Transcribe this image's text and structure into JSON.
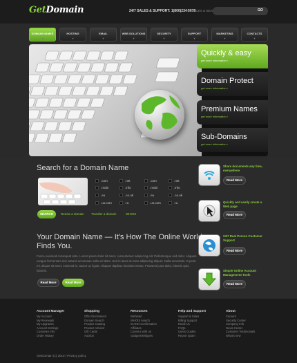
{
  "header": {
    "logo_a": "Get",
    "logo_b": "Domain",
    "support": "24/7 SALES & SUPPORT: 1(800)234 5678",
    "visit": "VISIT SALES & SEARCH",
    "search_button": "GO"
  },
  "nav": [
    {
      "label": "DOMAIN NAMES",
      "active": true
    },
    {
      "label": "HOSTING",
      "active": false
    },
    {
      "label": "EMAIL",
      "active": false
    },
    {
      "label": "WEB SOLUTIONS",
      "active": false
    },
    {
      "label": "SECURITY",
      "active": false
    },
    {
      "label": "SUPPORT",
      "active": false
    },
    {
      "label": "MARKETING",
      "active": false
    },
    {
      "label": "CONTACTS",
      "active": false
    }
  ],
  "banner": {
    "tabs": [
      {
        "title": "Quickly & easy",
        "more": "get more information ›"
      },
      {
        "title": "Domain Protect",
        "more": "get more information ›"
      },
      {
        "title": "Premium Names",
        "more": "get more information ›"
      },
      {
        "title": "Sub-Domains",
        "more": "get more information ›"
      }
    ]
  },
  "domain_search": {
    "title": "Search for a Domain Name",
    "tlds": [
      ".com",
      ".net",
      ".com",
      ".net",
      ".mobi",
      ".info",
      ".mobi",
      ".info",
      ".eu",
      ".co.uk",
      ".eu",
      ".co.uk",
      ".us.com",
      ".ru",
      ".us.com",
      ".ru"
    ],
    "search_button": "SEARCH",
    "links": [
      "Renew a domain",
      "Transfer a domain",
      "WHOIS"
    ]
  },
  "intro": {
    "title": "Your Domain Name — It's How The Online World Finds You.",
    "body": "Fusce euismod consequat ante. Lorem ipsum dolor sit amet, consectetuer adipiscing elit. Pellentesque sed dolor. Aliquam congue fermentum nisl. Mauris accumsan nulla vel diam. Sed in lacus ut enim adipiscing aliquet. Nulla venenatis. In pede mi, aliquet sit amet, euismod in, auctor ut, ligula. Aliquam dapibus tincidunt metus. Praesent justo dolor, lobortis quis, lobortis.",
    "btn_read_more": "Read More",
    "btn_read_more_2": "Read More"
  },
  "features": [
    {
      "icon": "wifi-icon",
      "text": "Share documents any time, everywhere",
      "btn": "Read More"
    },
    {
      "icon": "cursor-icon",
      "text": "Quickly and easily create a Web page",
      "btn": "Read More"
    },
    {
      "icon": "globe-icon",
      "text": "24/7 Real Person Customer Support",
      "btn": "Read More"
    },
    {
      "icon": "download-arrow-icon",
      "text": "Simple Online Account Management Tools",
      "btn": "Read More"
    }
  ],
  "footer": {
    "columns": [
      {
        "head": "Account Manager",
        "items": [
          "My Account",
          "My Renewals",
          "My Upgrades",
          "Account Settings",
          "Customer Info",
          "Order History"
        ]
      },
      {
        "head": "Shopping",
        "items": [
          "Offer Disclaimers",
          "Domain Search",
          "Product Catalog",
          "Product Advisor",
          "Gift Cards",
          "Auction"
        ]
      },
      {
        "head": "Resources",
        "items": [
          "Webmail",
          "WHOIS search",
          "ICANN Confirmation",
          "Affiliates",
          "Connect with us",
          "Gadgets/Widgets"
        ]
      },
      {
        "head": "Help and Support",
        "items": [
          "Support & Sales",
          "Billing Support",
          "Email Us",
          "FAQs",
          "Users Guides",
          "Report Spam"
        ]
      },
      {
        "head": "About",
        "items": [
          "Careers",
          "Security Center",
          "Company Info",
          "News Center",
          "Customer Testimonials",
          "What's new"
        ]
      }
    ],
    "copyright": "GetDomain (c) 2010  |  Privacy policy"
  }
}
